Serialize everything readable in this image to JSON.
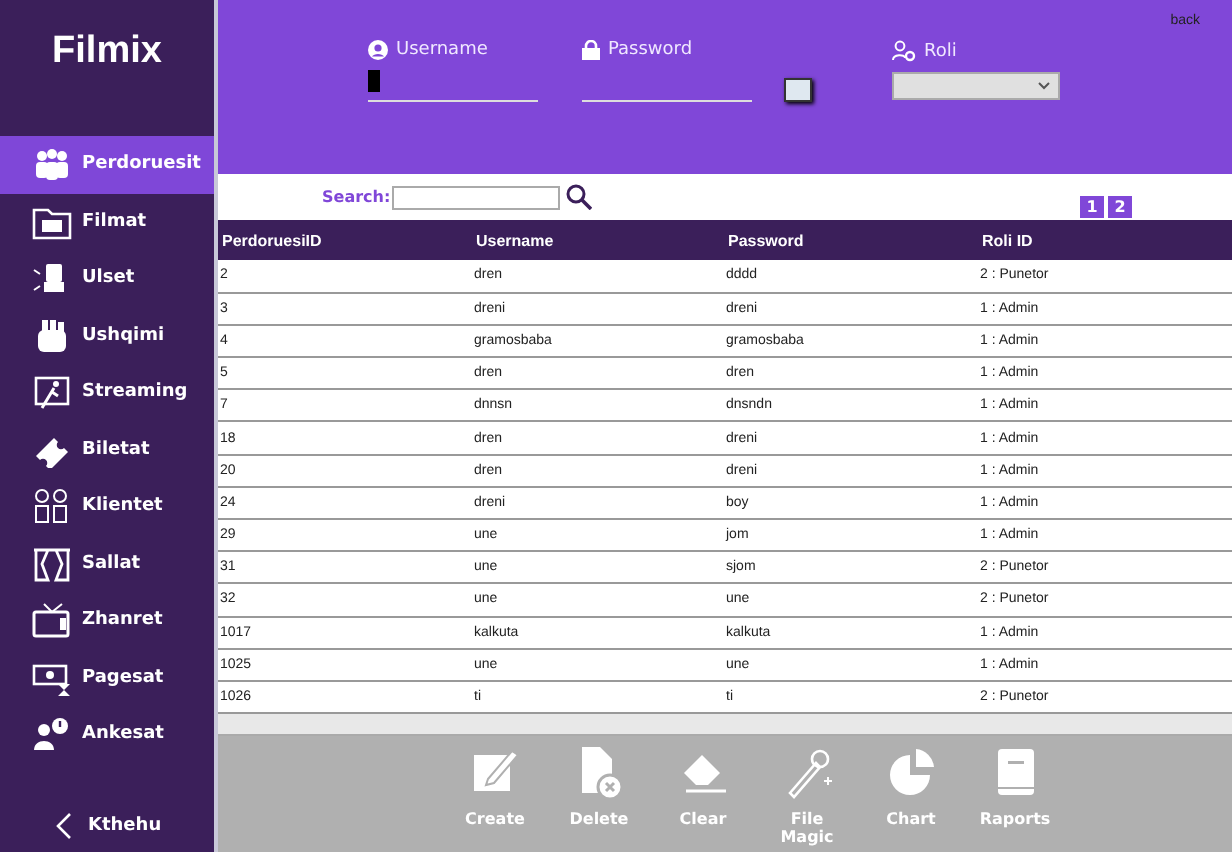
{
  "app": {
    "title": "Filmix"
  },
  "sidebar": {
    "items": [
      {
        "label": "Perdoruesit",
        "selected": true
      },
      {
        "label": "Filmat",
        "selected": false
      },
      {
        "label": "Ulset",
        "selected": false
      },
      {
        "label": "Ushqimi",
        "selected": false
      },
      {
        "label": "Streaming",
        "selected": false
      },
      {
        "label": "Biletat",
        "selected": false
      },
      {
        "label": "Klientet",
        "selected": false
      },
      {
        "label": "Sallat",
        "selected": false
      },
      {
        "label": "Zhanret",
        "selected": false
      },
      {
        "label": "Pagesat",
        "selected": false
      },
      {
        "label": "Ankesat",
        "selected": false
      }
    ],
    "back": "Kthehu"
  },
  "form": {
    "back_link": "back",
    "username_label": "Username",
    "password_label": "Password",
    "role_label": "Roli"
  },
  "search": {
    "label": "Search:"
  },
  "pages": [
    "1",
    "2"
  ],
  "table": {
    "columns": [
      "PerdoruesiID",
      "Username",
      "Password",
      "Roli ID"
    ],
    "rows": [
      [
        "2",
        "dren",
        "dddd",
        "2 : Punetor"
      ],
      [
        "3",
        "dreni",
        "dreni",
        "1 : Admin"
      ],
      [
        "4",
        "gramosbaba",
        "gramosbaba",
        "1 : Admin"
      ],
      [
        "5",
        "dren",
        "dren",
        "1 : Admin"
      ],
      [
        "7",
        "dnnsn",
        "dnsndn",
        "1 : Admin"
      ],
      [
        "18",
        "dren",
        "dreni",
        "1 : Admin"
      ],
      [
        "20",
        "dren",
        "dreni",
        "1 : Admin"
      ],
      [
        "24",
        "dreni",
        "boy",
        "1 : Admin"
      ],
      [
        "29",
        "une",
        "jom",
        "1 : Admin"
      ],
      [
        "31",
        "une",
        "sjom",
        "2 : Punetor"
      ],
      [
        "32",
        "une",
        "une",
        "2 : Punetor"
      ],
      [
        "1017",
        "kalkuta",
        "kalkuta",
        "1 : Admin"
      ],
      [
        "1025",
        "une",
        "une",
        "1 : Admin"
      ],
      [
        "1026",
        "ti",
        "ti",
        "2 : Punetor"
      ]
    ]
  },
  "toolbar": [
    "Create",
    "Delete",
    "Clear",
    "File Magic",
    "Chart",
    "Raports"
  ]
}
